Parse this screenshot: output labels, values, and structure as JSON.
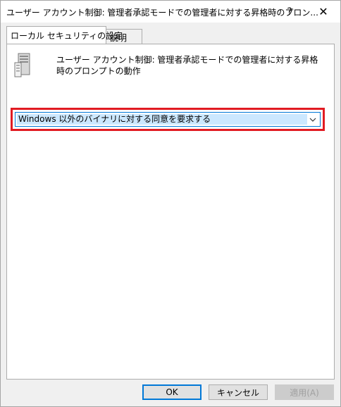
{
  "window": {
    "title": "ユーザー アカウント制御: 管理者承認モードでの管理者に対する昇格時のプロン...",
    "help_label": "?",
    "close_label": "✕"
  },
  "tabs": [
    {
      "label": "ローカル セキュリティの設定",
      "active": true
    },
    {
      "label": "説明",
      "active": false
    }
  ],
  "panel": {
    "icon": "server-policy-icon",
    "description": "ユーザー アカウント制御: 管理者承認モードでの管理者に対する昇格時のプロンプトの動作",
    "dropdown_value": "Windows 以外のバイナリに対する同意を要求する"
  },
  "buttons": {
    "ok": "OK",
    "cancel": "キャンセル",
    "apply": "適用(A)"
  },
  "colors": {
    "highlight": "#e11b22",
    "focus": "#0078d7",
    "selection": "#cce8ff"
  }
}
